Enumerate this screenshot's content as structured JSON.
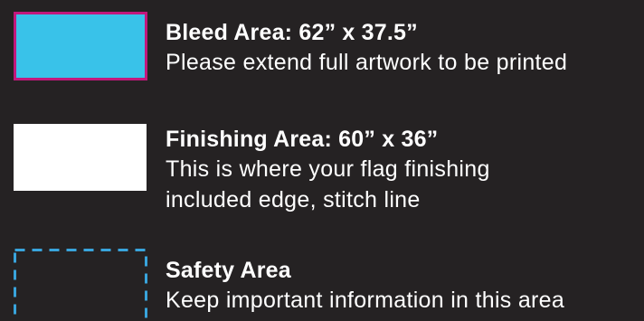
{
  "colors": {
    "background": "#252223",
    "bleed_fill": "#39c2e9",
    "bleed_border": "#c2187c",
    "finishing_fill": "#ffffff",
    "safety_dash": "#39a4dc"
  },
  "legend": {
    "bleed": {
      "title": "Bleed Area: 62” x 37.5”",
      "description": "Please extend full artwork to be printed"
    },
    "finishing": {
      "title": "Finishing Area: 60” x 36”",
      "description_line1": "This is where your flag finishing",
      "description_line2": "included edge, stitch line"
    },
    "safety": {
      "title": "Safety Area",
      "description": "Keep important information in this area"
    }
  }
}
